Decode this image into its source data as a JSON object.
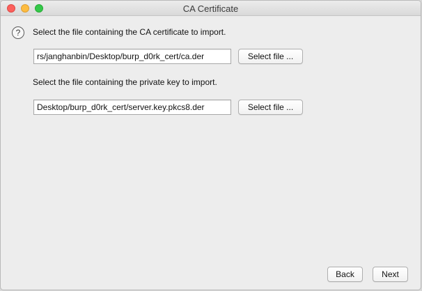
{
  "window": {
    "title": "CA Certificate"
  },
  "ca_certificate": {
    "prompt": "Select the file containing the CA certificate to import.",
    "path_value": "rs/janghanbin/Desktop/burp_d0rk_cert/ca.der",
    "select_label": "Select file ..."
  },
  "private_key": {
    "prompt": "Select the file containing the private key to import.",
    "path_value": "Desktop/burp_d0rk_cert/server.key.pkcs8.der",
    "select_label": "Select file ..."
  },
  "footer": {
    "back_label": "Back",
    "next_label": "Next"
  },
  "icons": {
    "help": "?"
  }
}
